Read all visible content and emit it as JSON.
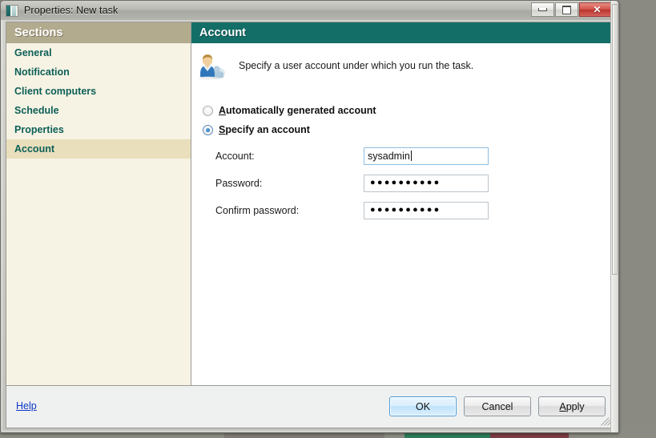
{
  "window": {
    "title": "Properties: New task",
    "icon": "app-window-icon",
    "controls": {
      "minimize": "minimize-icon",
      "maximize": "maximize-icon",
      "close": "✕"
    }
  },
  "colors": {
    "accent_teal": "#136e68",
    "sidebar_header": "#b3ab8e",
    "sidebar_bg": "#f6f3e4",
    "sidebar_selected": "#e9dfbc",
    "sidebar_link": "#0d5f57",
    "help_link": "#0b36c8"
  },
  "sidebar": {
    "header": "Sections",
    "items": [
      {
        "label": "General",
        "selected": false
      },
      {
        "label": "Notification",
        "selected": false
      },
      {
        "label": "Client computers",
        "selected": false
      },
      {
        "label": "Schedule",
        "selected": false
      },
      {
        "label": "Properties",
        "selected": false
      },
      {
        "label": "Account",
        "selected": true
      }
    ]
  },
  "content": {
    "header": "Account",
    "icon": "user-account-icon",
    "description": "Specify a user account under which you run the task.",
    "radios": [
      {
        "accel": "A",
        "before": "",
        "after": "utomatically generated account",
        "selected": false
      },
      {
        "accel": "S",
        "before": "",
        "after": "pecify an account",
        "selected": true
      }
    ],
    "fields": [
      {
        "label": "Account:",
        "value": "sysadmin",
        "placeholder": "",
        "type": "text",
        "focused": true
      },
      {
        "label": "Password:",
        "value": "●●●●●●●●●●",
        "placeholder": "",
        "type": "password",
        "focused": false
      },
      {
        "label": "Confirm password:",
        "value": "●●●●●●●●●●",
        "placeholder": "",
        "type": "password",
        "focused": false
      }
    ]
  },
  "footer": {
    "help": "Help",
    "buttons": [
      {
        "label": "OK",
        "accel": "",
        "default": true
      },
      {
        "label": "Cancel",
        "accel": "",
        "default": false
      },
      {
        "label": "Apply",
        "accel": "A",
        "default": false
      }
    ]
  }
}
